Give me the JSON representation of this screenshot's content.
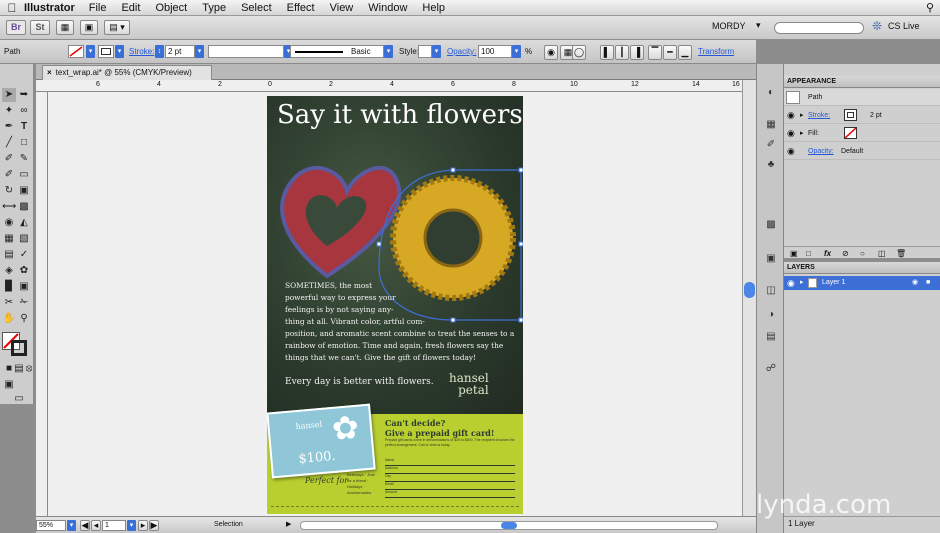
{
  "menubar": {
    "app": "Illustrator",
    "items": [
      "File",
      "Edit",
      "Object",
      "Type",
      "Select",
      "Effect",
      "View",
      "Window",
      "Help"
    ],
    "workspace": "MORDY",
    "cs_live": "CS Live"
  },
  "appbar": {
    "br_label": "Br",
    "st_label": "St"
  },
  "control": {
    "selection": "Path",
    "stroke_label": "Stroke:",
    "stroke_weight": "2 pt",
    "brush_style": "Basic",
    "style_label": "Style:",
    "opacity_label": "Opacity:",
    "opacity_value": "100",
    "opacity_unit": "%",
    "transform_label": "Transform"
  },
  "document": {
    "tab_title": "text_wrap.ai* @ 55% (CMYK/Preview)",
    "ruler_ticks": [
      "6",
      "4",
      "2",
      "0",
      "2",
      "4",
      "6",
      "8",
      "10",
      "12",
      "14",
      "16"
    ]
  },
  "artwork": {
    "headline": "Say it with flowers",
    "body": [
      "SOMETIMES, the most",
      "powerful way to express your",
      "feelings is by not saying any-",
      "thing at all. Vibrant color, artful com-",
      "position, and aromatic scent combine to treat the senses to a",
      "rainbow of emotion. Time and again, fresh flowers say the",
      "things that we can't. Give the gift of flowers today!"
    ],
    "tagline": "Every day is better with flowers.",
    "brand_line1": "hansel",
    "brand_line2": "petal",
    "card_brand": "hansel",
    "card_price": "$100.",
    "card_caption": "Perfect for",
    "card_caption_side": "Birthdays · Just for a friend · Holidays · Anniversaries",
    "promo_title1": "Can't decide?",
    "promo_title2": "Give a prepaid gift card!",
    "promo_body": "Prepaid gift cards come in denominations of $25 to $500. The recipient chooses the perfect arrangement. Call or visit us today.",
    "form_fields": [
      "Name",
      "Address",
      "City",
      "Email",
      "Amount"
    ]
  },
  "status": {
    "zoom": "55%",
    "page": "1",
    "mode": "Selection",
    "layers_count": "1 Layer"
  },
  "appearance": {
    "title": "APPEARANCE",
    "object": "Path",
    "stroke_label": "Stroke:",
    "stroke_value": "2 pt",
    "fill_label": "Fill:",
    "opacity_label": "Opacity:",
    "opacity_value": "Default"
  },
  "layers": {
    "title": "LAYERS",
    "layer_name": "Layer 1"
  },
  "watermark": "lynda.com",
  "colors": {
    "selection_blue": "#3d6fd6",
    "poster_green": "#2d3a2e",
    "promo_lime": "#b9cf2f",
    "card_blue": "#8fc7d8",
    "wreath_gold": "#d6a824",
    "heart_red": "#a8363f"
  }
}
